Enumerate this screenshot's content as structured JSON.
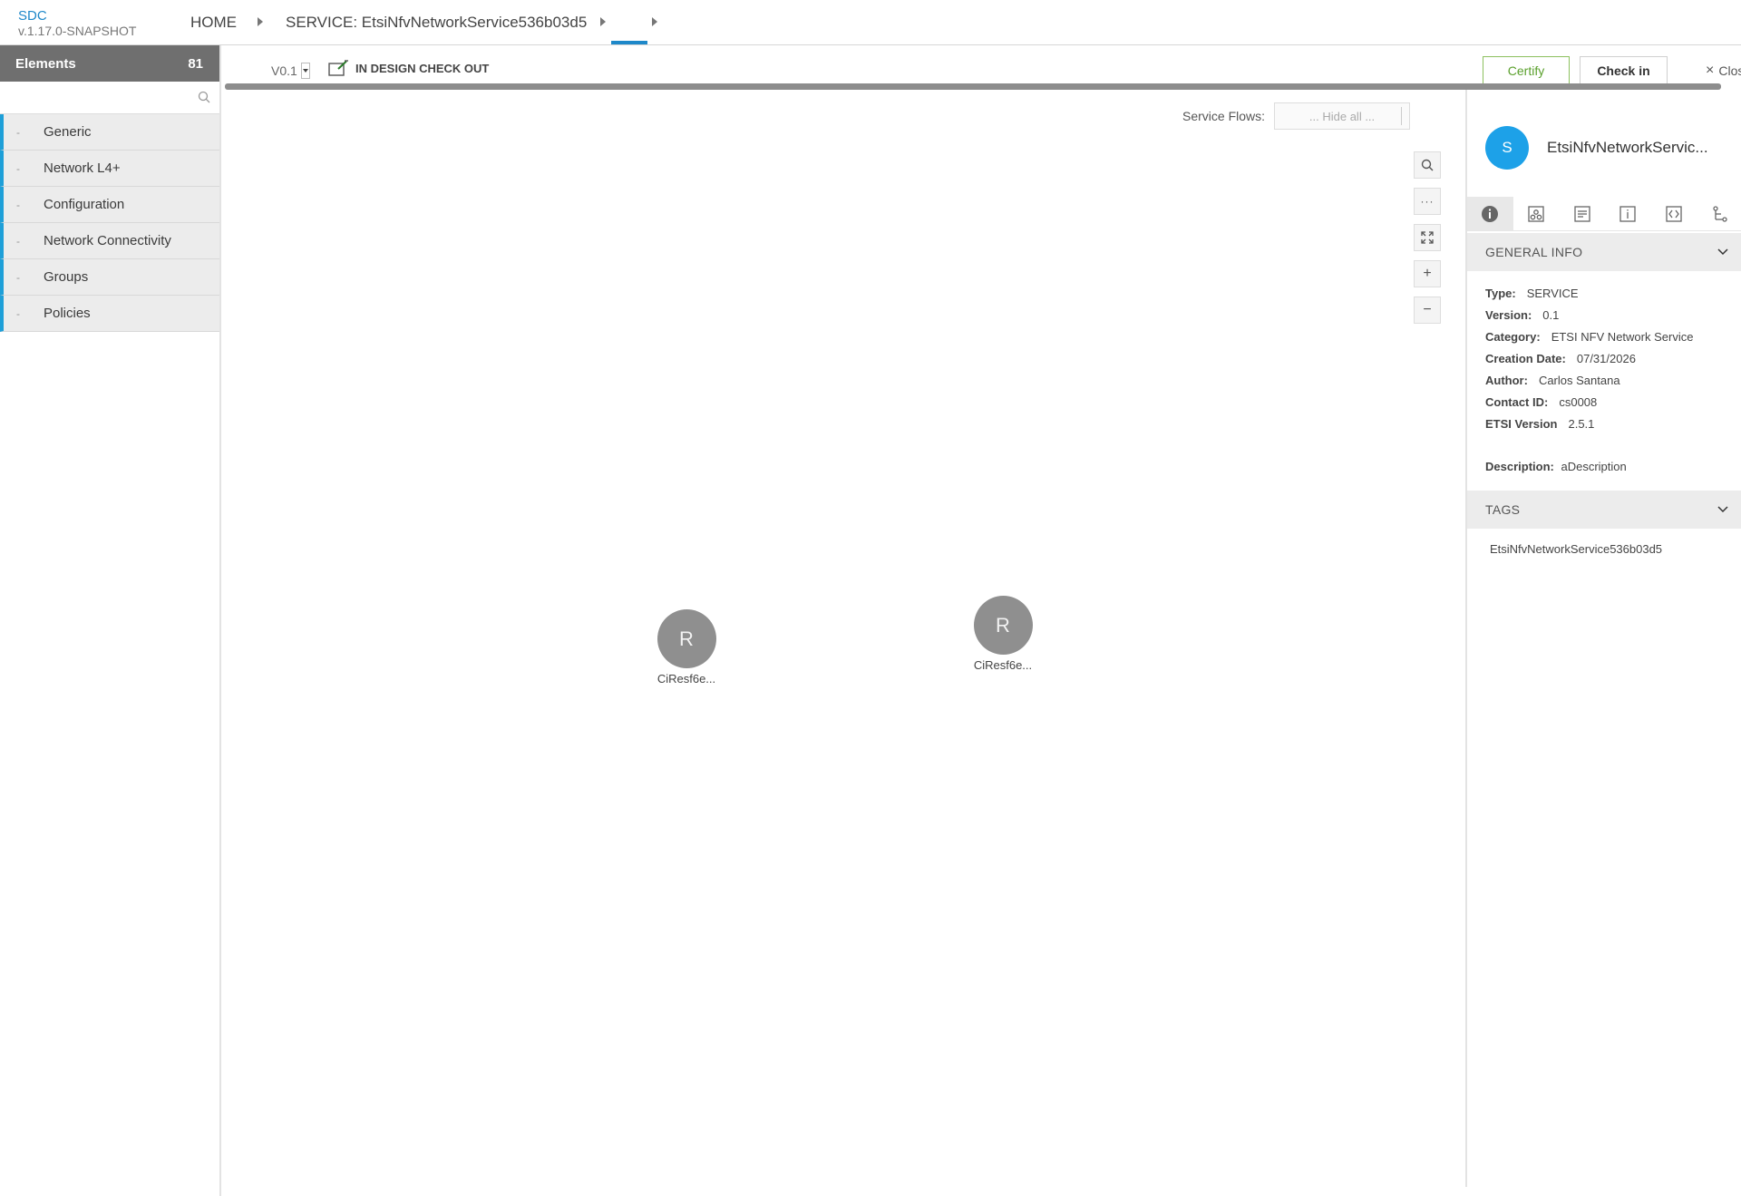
{
  "header": {
    "app_name": "SDC",
    "app_version": "v.1.17.0-SNAPSHOT",
    "breadcrumb": {
      "home": "HOME",
      "service": "SERVICE: EtsiNfvNetworkService536b03d5",
      "third": ""
    }
  },
  "palette": {
    "title": "Elements",
    "count": "81",
    "search_placeholder": "",
    "categories": [
      {
        "label": "Generic"
      },
      {
        "label": "Network L4+"
      },
      {
        "label": "Configuration"
      },
      {
        "label": "Network Connectivity"
      },
      {
        "label": "Groups"
      },
      {
        "label": "Policies"
      }
    ]
  },
  "toolbar": {
    "version": "V0.1",
    "status": "IN DESIGN CHECK OUT",
    "certify_label": "Certify",
    "checkin_label": "Check in",
    "close_label": "Close"
  },
  "canvas": {
    "service_flows_label": "Service Flows:",
    "service_flows_value": "... Hide all ...",
    "nodes": [
      {
        "letter": "R",
        "label": "CiResf6e..."
      },
      {
        "letter": "R",
        "label": "CiResf6e..."
      }
    ]
  },
  "details": {
    "avatar_letter": "S",
    "name": "EtsiNfvNetworkServic...",
    "general_info_title": "GENERAL INFO",
    "fields": [
      {
        "key": "Type:",
        "value": "SERVICE"
      },
      {
        "key": "Version:",
        "value": "0.1"
      },
      {
        "key": "Category:",
        "value": "ETSI NFV Network Service"
      },
      {
        "key": "Creation Date:",
        "value": "07/31/2026"
      },
      {
        "key": "Author:",
        "value": "Carlos Santana"
      },
      {
        "key": "Contact ID:",
        "value": "cs0008"
      },
      {
        "key": "ETSI Version",
        "value": "2.5.1"
      }
    ],
    "description_key": "Description:",
    "description_value": "aDescription",
    "tags_title": "TAGS",
    "tags": [
      "EtsiNfvNetworkService536b03d5"
    ]
  },
  "colors": {
    "accent": "#1e88c9",
    "category_bar": "#1e9fd8",
    "certify": "#5aa02c",
    "avatar": "#1da1e8",
    "node": "#8f8f8f"
  }
}
